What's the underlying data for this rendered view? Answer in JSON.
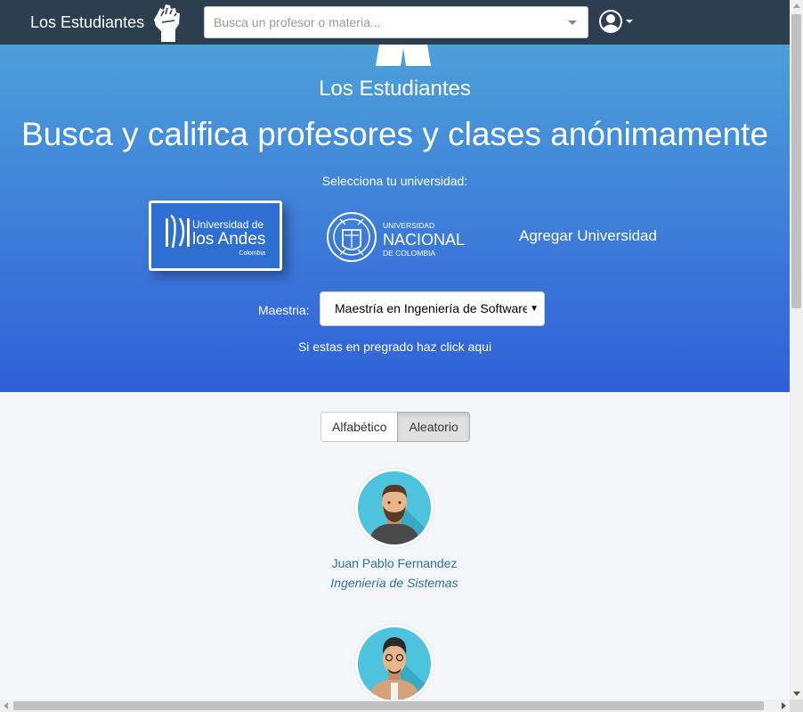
{
  "navbar": {
    "brand": "Los Estudiantes",
    "search_placeholder": "Busca un profesor o materia...",
    "icons": {
      "brand": "raised-fist-icon",
      "search_dropdown": "caret-down-icon",
      "user": "user-circle-icon"
    }
  },
  "hero": {
    "subtitle": "Los Estudiantes",
    "title": "Busca y califica profesores y clases anónimamente",
    "select_university_label": "Selecciona tu universidad:",
    "universities": [
      {
        "name_line1": "Universidad de",
        "name_line2": "los Andes",
        "name_line3": "Colombia"
      },
      {
        "name_line1": "UNIVERSIDAD",
        "name_line2": "NACIONAL",
        "name_line3": "DE COLOMBIA"
      }
    ],
    "add_university": "Agregar Universidad",
    "maestria_label": "Maestria:",
    "maestria_value": "Maestría en Ingeniería de Software",
    "pregrado_link": "Si estas en pregrado haz click aqui"
  },
  "sort": {
    "options": [
      "Alfabético",
      "Aleatorio"
    ],
    "active": "Aleatorio"
  },
  "professors": [
    {
      "name": "Juan Pablo Fernandez",
      "department": "Ingeniería de Sistemas"
    },
    {
      "name": "",
      "department": ""
    }
  ],
  "colors": {
    "navbar": "#2c3e50",
    "hero_top": "#4da0d9",
    "hero_bottom": "#2f5fd9",
    "andes_blue": "#2f6fd1",
    "link": "#2f6f9f",
    "avatar_bg": "#4ec3dd"
  }
}
